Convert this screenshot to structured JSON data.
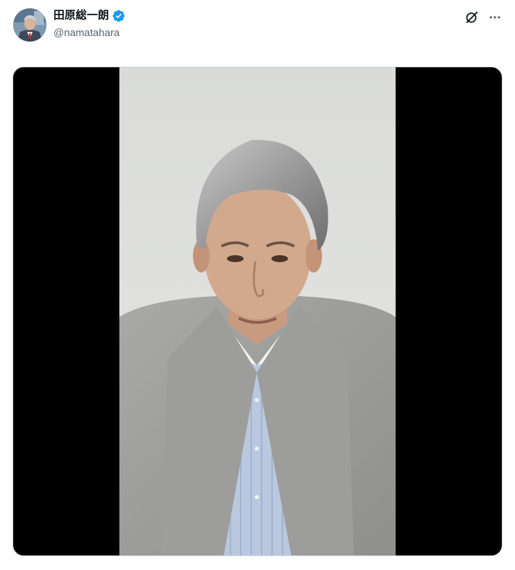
{
  "post": {
    "author": {
      "display_name": "田原総一朗",
      "handle": "@namatahara",
      "verified": true,
      "verified_icon": "verified-badge-icon",
      "avatar_icon": "profile-avatar"
    },
    "actions": {
      "grok_icon": "grok-icon",
      "more_icon": "more-horizontal-icon"
    },
    "media": {
      "type": "video",
      "frame_icon": "video-frame"
    }
  },
  "colors": {
    "text_primary": "#0f1419",
    "text_secondary": "#536471",
    "verified_blue": "#1d9bf0",
    "media_background": "#000000",
    "border": "#cfd9de"
  }
}
